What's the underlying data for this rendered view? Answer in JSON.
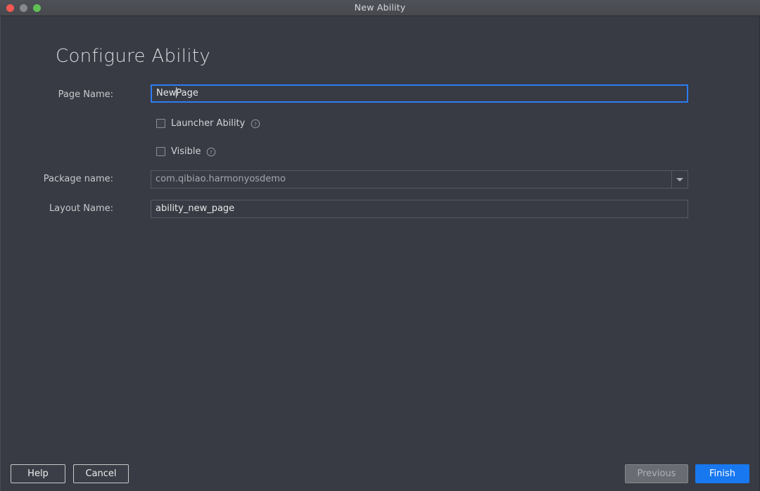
{
  "window": {
    "title": "New Ability",
    "traffic_lights": [
      "close-button",
      "minimize-button",
      "zoom-button"
    ]
  },
  "page": {
    "heading": "Configure Ability"
  },
  "form": {
    "page_name": {
      "label": "Page Name:",
      "value": "NewPage",
      "value_before_caret": "New",
      "value_after_caret": "Page",
      "focused": true
    },
    "launcher_ability": {
      "label": "Launcher Ability",
      "checked": false,
      "help_icon": "question-circle-icon"
    },
    "visible": {
      "label": "Visible",
      "checked": false,
      "help_icon": "question-circle-icon"
    },
    "package_name": {
      "label": "Package name:",
      "value": "com.qibiao.harmonyosdemo",
      "dropdown_icon": "chevron-down-icon"
    },
    "layout_name": {
      "label": "Layout Name:",
      "value": "ability_new_page"
    }
  },
  "footer": {
    "help": "Help",
    "cancel": "Cancel",
    "previous": "Previous",
    "finish": "Finish"
  },
  "colors": {
    "background": "#383b43",
    "titlebar": "#4a4d53",
    "accent": "#1878f0",
    "focus_border": "#2d7cf6",
    "traffic_red": "#f25a53",
    "traffic_yellow": "#87898d",
    "traffic_green": "#5fc154"
  }
}
